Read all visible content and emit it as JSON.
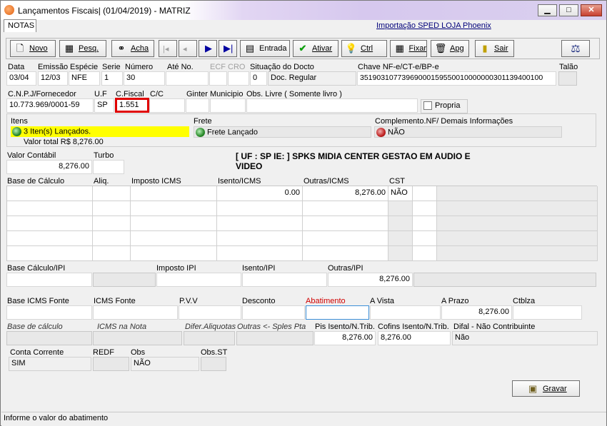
{
  "window": {
    "title": "Lançamentos Fiscais| (01/04/2019) - MATRIZ",
    "minimize": "▁",
    "maximize": "□",
    "close": "✕"
  },
  "tabs": {
    "notas": "NOTAS"
  },
  "import_link": "Importação SPED LOJA Phoenix",
  "toolbar": {
    "novo": "Novo",
    "pesq": "Pesq.",
    "acha": "Acha",
    "entrada": "Entrada",
    "ativar": "Ativar",
    "ctrl": "Ctrl",
    "fixar": "Fixar",
    "apg": "Apg",
    "sair": "Sair"
  },
  "labels": {
    "data": "Data",
    "emissao": "Emissão",
    "especie": "Espécie",
    "serie": "Serie",
    "numero": "Número",
    "ate_no": "Até No.",
    "ecf": "ECF",
    "cro": "CRO",
    "situacao": "Situação do Docto",
    "chave": "Chave NF-e/CT-e/BP-e",
    "talao": "Talão",
    "cnpj": "C.N.P.J/Fornecedor",
    "uf": "U.F",
    "cfiscal": "C.Fiscal",
    "cc": "C/C",
    "ginter": "Ginter",
    "municipio": "Municipio",
    "obs_livre": "Obs. Livre ( Somente livro )",
    "propria": "Propria",
    "itens": "Itens",
    "frete": "Frete",
    "complemento": "Complemento.NF/ Demais Informações",
    "valor_contabil": "Valor Contábil",
    "turbo": "Turbo",
    "base_calculo": "Base de Cálculo",
    "aliq": "Aliq.",
    "imposto_icms": "Imposto ICMS",
    "isento_icms": "Isento/ICMS",
    "outras_icms": "Outras/ICMS",
    "cst": "CST",
    "base_ipi": "Base Cálculo/IPI",
    "imposto_ipi": "Imposto IPI",
    "isento_ipi": "Isento/IPI",
    "outras_ipi": "Outras/IPI",
    "base_icms_fonte": "Base ICMS Fonte",
    "icms_fonte": "ICMS Fonte",
    "pvv": "P.V.V",
    "desconto": "Desconto",
    "abatimento": "Abatimento",
    "a_vista": "A Vista",
    "a_prazo": "A Prazo",
    "ctblza": "Ctblza",
    "base_calc_it": "Base de cálculo",
    "icms_nota": "ICMS na Nota",
    "difer_aliq": "Difer.Aliquotas",
    "outras_sples": "Outras <- Sples Pta",
    "pis_isento": "Pis Isento/N.Trib.",
    "cofins_isento": "Cofins Isento/N.Trib.",
    "difal": "Difal - Não Contribuinte",
    "conta_corrente": "Conta Corrente",
    "redf": "REDF",
    "obs": "Obs",
    "obs_st": "Obs.ST",
    "gravar": "Gravar"
  },
  "values": {
    "data": "03/04",
    "emissao": "12/03",
    "especie": "NFE",
    "serie": "1",
    "numero": "30",
    "situacao_code": "0",
    "situacao_text": "Doc. Regular",
    "chave": "35190310773969000159550010000000301139400100",
    "cnpj": "10.773.969/0001-59",
    "uf": "SP",
    "cfiscal": "1.551",
    "itens": "3 Iten(s) Lançados.",
    "valor_total": "Valor total R$ 8,276.00",
    "frete": "Frete Lançado",
    "complemento": "NÃO",
    "valor_contabil": "8,276.00",
    "header_info": "[ UF : SP IE:  ] SPKS MIDIA CENTER GESTAO EM AUDIO E VIDEO",
    "isento_icms": "0.00",
    "outras_icms": "8,276.00",
    "cst": "NÃO",
    "outras_ipi": "8,276.00",
    "a_prazo": "8,276.00",
    "pis_isento": "8,276.00",
    "cofins_isento": "8,276.00",
    "difal": "Não",
    "conta_corrente": "SIM",
    "obs": "NÃO"
  },
  "status_bar": "Informe o valor do abatimento"
}
